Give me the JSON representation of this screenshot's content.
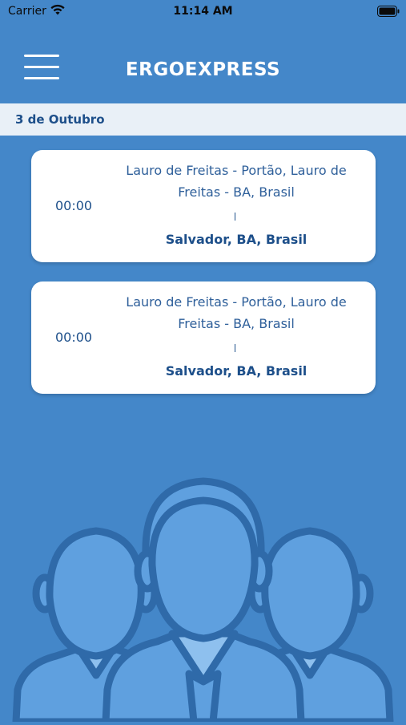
{
  "status_bar": {
    "carrier": "Carrier",
    "time": "11:14 AM"
  },
  "header": {
    "title": "ERGOEXPRESS",
    "menu_icon": "hamburger-menu-icon"
  },
  "date_section": {
    "label": "3 de Outubro"
  },
  "trips": [
    {
      "time": "00:00",
      "origin": "Lauro de Freitas - Portão, Lauro de Freitas - BA, Brasil",
      "destination": "Salvador, BA, Brasil"
    },
    {
      "time": "00:00",
      "origin": "Lauro de Freitas - Portão, Lauro de Freitas - BA, Brasil",
      "destination": "Salvador, BA, Brasil"
    }
  ],
  "colors": {
    "background": "#4487c9",
    "date_bar": "#e9f0f7",
    "text_primary": "#1d4f8a",
    "card": "#ffffff"
  }
}
